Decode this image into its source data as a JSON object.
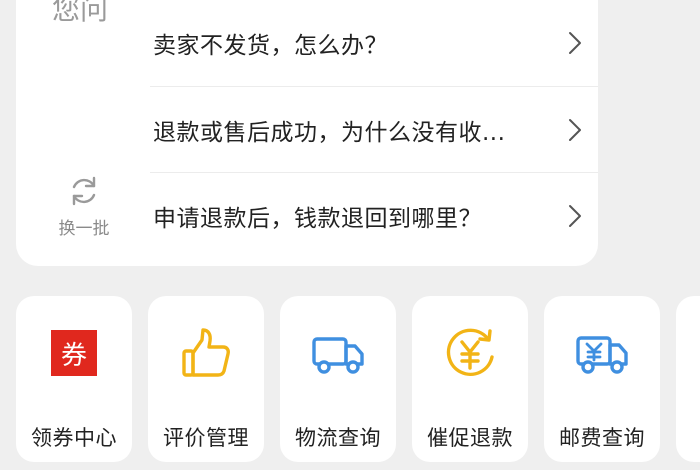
{
  "faq": {
    "side_title": "您问",
    "refresh_label": "换一批",
    "items": [
      {
        "text": "卖家不发货，怎么办？"
      },
      {
        "text": "退款或售后成功，为什么没有收..."
      },
      {
        "text": "申请退款后，钱款退回到哪里？"
      }
    ]
  },
  "tools": [
    {
      "label": "领券中心",
      "icon": "coupon-icon",
      "icon_text": "券",
      "color": "#e0281e"
    },
    {
      "label": "评价管理",
      "icon": "thumbs-up-icon",
      "color": "#f2b416"
    },
    {
      "label": "物流查询",
      "icon": "truck-icon",
      "color": "#3f8fe0"
    },
    {
      "label": "催促退款",
      "icon": "yuan-refund-icon",
      "color": "#f2b416"
    },
    {
      "label": "邮费查询",
      "icon": "postage-truck-icon",
      "color": "#3f8fe0"
    }
  ]
}
